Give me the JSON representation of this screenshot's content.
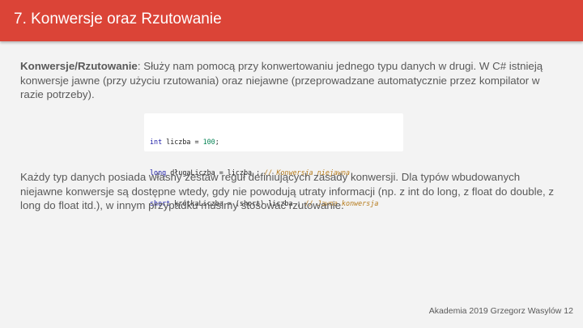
{
  "header": {
    "title": "7. Konwersje oraz Rzutowanie"
  },
  "intro": {
    "term": "Konwersje/Rzutowanie",
    "text": ": Służy nam pomocą przy konwertowaniu jednego typu danych w drugi. W C# istnieją konwersje jawne (przy użyciu rzutowania) oraz niejawne (przeprowadzane automatycznie przez kompilator w razie potrzeby)."
  },
  "code": {
    "line1": {
      "keyword": "int",
      "text": " liczba = ",
      "number": "100",
      "end": ";"
    },
    "line2": {
      "keyword": "long",
      "text": " długaLiczba = liczba ; ",
      "comment": "// Konwersja niejawna"
    },
    "line3": {
      "keyword": "short",
      "text": " krótkaLiczba = (short) liczba ; ",
      "comment": "// Jawna konwersja"
    }
  },
  "body": {
    "text": "Każdy typ danych posiada własny zestaw reguł definiujących zasady konwersji. Dla typów wbudowanych niejawne konwersje są dostępne wtedy, gdy nie powodują utraty informacji (np. z int do long, z float do double, z long do float itd.), w innym przypadku musimy stosować rzutowanie."
  },
  "footer": {
    "text": "Akademia 2019 Grzegorz Wasylów 12"
  }
}
